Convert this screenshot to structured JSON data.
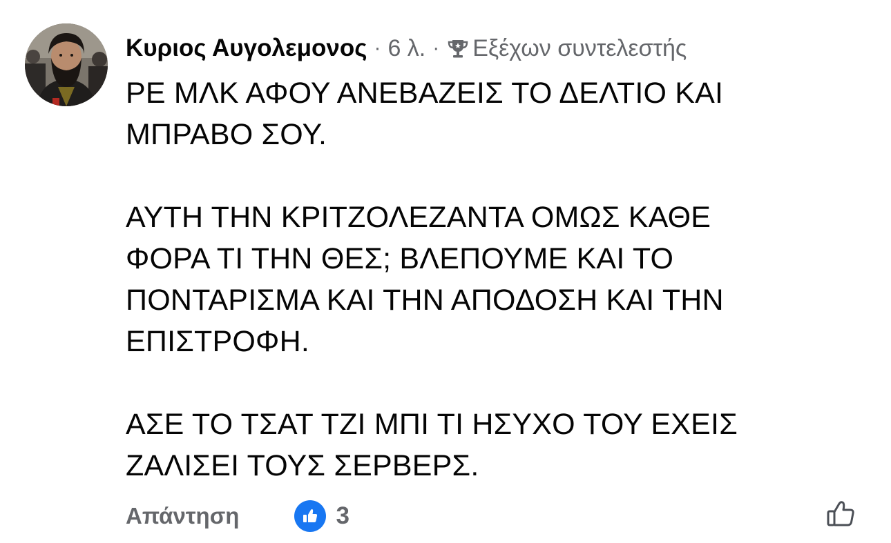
{
  "comment": {
    "author": "Κυριος Αυγολεμονος",
    "separator": "·",
    "time": "6 λ.",
    "badge": {
      "icon": "trophy-icon",
      "label": "Εξέχων συντελεστής"
    },
    "text": "ΡΕ ΜΛΚ ΑΦΟΥ ΑΝΕΒΑΖΕΙΣ ΤΟ ΔΕΛΤΙΟ ΚΑΙ\nΜΠΡΑΒΟ ΣΟΥ.\n\nΑΥΤΗ ΤΗΝ ΚΡΙΤΖΟΛΕΖΑΝΤΑ ΟΜΩΣ ΚΑΘΕ\nΦΟΡΑ ΤΙ ΤΗΝ ΘΕΣ; ΒΛΕΠΟΥΜΕ ΚΑΙ ΤΟ\nΠΟΝΤΑΡΙΣΜΑ ΚΑΙ ΤΗΝ ΑΠΟΔΟΣΗ ΚΑΙ ΤΗΝ\nΕΠΙΣΤΡΟΦΗ.\n\nΑΣΕ ΤΟ ΤΣΑΤ ΤΖΙ ΜΠΙ ΤΙ ΗΣΥΧΟ ΤΟΥ ΕΧΕΙΣ\nΖΑΛΙΣΕΙ ΤΟΥΣ ΣΕΡΒΕΡΣ."
  },
  "actions": {
    "reply_label": "Απάντηση",
    "reaction_icon": "like-reaction-icon",
    "reaction_count": "3",
    "like_icon": "thumbs-up-outline-icon"
  },
  "colors": {
    "text": "#050505",
    "secondary": "#65676b",
    "facebook_blue": "#1877f2"
  }
}
